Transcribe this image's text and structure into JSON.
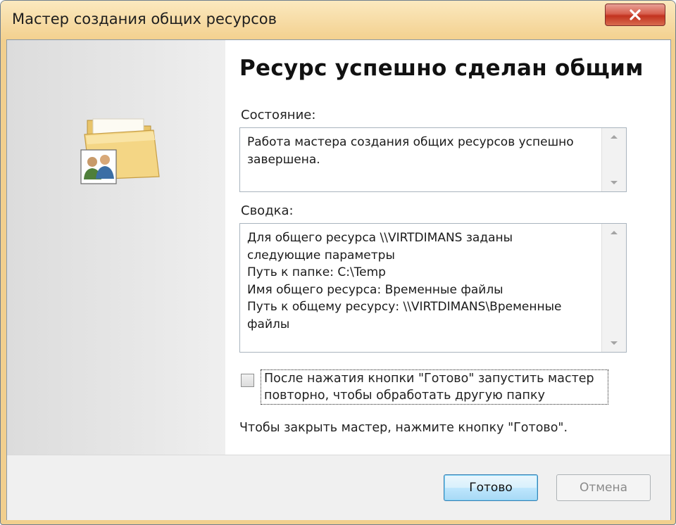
{
  "window": {
    "title": "Мастер создания общих ресурсов",
    "close_icon": "close-icon"
  },
  "main": {
    "heading": "Ресурс успешно сделан общим",
    "status_label": "Состояние:",
    "status_text": "Работа мастера создания общих ресурсов успешно\nзавершена.",
    "summary_label": "Сводка:",
    "summary_text": "Для общего ресурса \\\\VIRTDIMANS заданы\nследующие параметры\nПуть к папке: C:\\Temp\nИмя общего ресурса: Временные файлы\nПуть к общему ресурсу: \\\\VIRTDIMANS\\Временные\nфайлы",
    "rerun_checkbox_label": "После нажатия кнопки \"Готово\" запустить мастер повторно, чтобы обработать другую папку",
    "rerun_checked": false,
    "close_hint": "Чтобы закрыть мастер, нажмите кнопку \"Готово\"."
  },
  "buttons": {
    "finish": "Готово",
    "cancel": "Отмена"
  },
  "icons": {
    "wizard": "shared-folder-icon"
  },
  "colors": {
    "titlebar": "#f3d08e",
    "close_button": "#c7402b",
    "finish_button_border": "#3c7fb1"
  }
}
